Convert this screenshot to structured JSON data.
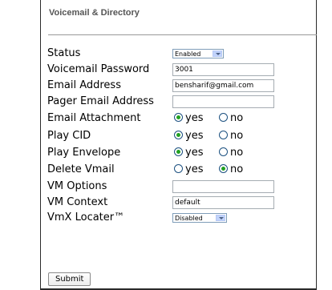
{
  "section_title": "Voicemail & Directory",
  "fields": {
    "status": {
      "label": "Status",
      "value": "Enabled"
    },
    "voicemail_password": {
      "label": "Voicemail Password",
      "value": "3001"
    },
    "email_address": {
      "label": "Email Address",
      "value": "bensharif@gmail.com"
    },
    "pager_email_address": {
      "label": "Pager Email Address",
      "value": ""
    },
    "email_attachment": {
      "label": "Email Attachment",
      "yes": "yes",
      "no": "no",
      "selected": "yes"
    },
    "play_cid": {
      "label": "Play CID",
      "yes": "yes",
      "no": "no",
      "selected": "yes"
    },
    "play_envelope": {
      "label": "Play Envelope",
      "yes": "yes",
      "no": "no",
      "selected": "yes"
    },
    "delete_vmail": {
      "label": "Delete Vmail",
      "yes": "yes",
      "no": "no",
      "selected": "no"
    },
    "vm_options": {
      "label": "VM Options",
      "value": ""
    },
    "vm_context": {
      "label": "VM Context",
      "value": "default"
    },
    "vmx_locater": {
      "label": "VmX Locater™",
      "value": "Disabled"
    }
  },
  "submit_label": "Submit"
}
